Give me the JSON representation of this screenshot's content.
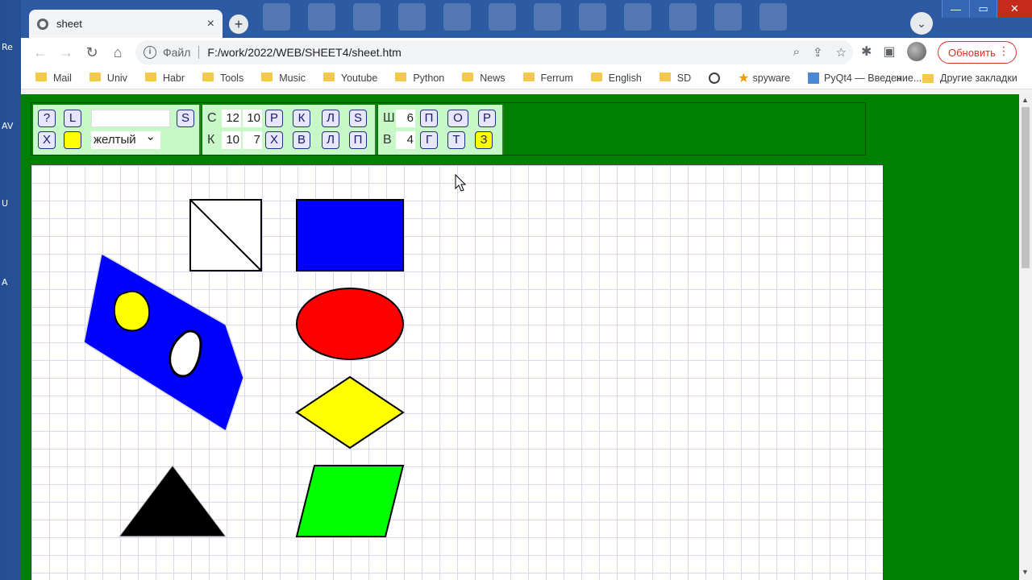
{
  "desktop": {
    "labels": [
      "Re",
      "AV",
      "U",
      "A"
    ]
  },
  "browser": {
    "tab_title": "sheet",
    "tab_close": "×",
    "new_tab": "+",
    "tab_list": "⌄",
    "window_controls": {
      "minimize": "—",
      "maximize": "▭",
      "close": "✕"
    },
    "nav": {
      "back": "←",
      "forward": "→",
      "reload": "↻",
      "home": "⌂"
    },
    "address": {
      "scheme_label": "Файл",
      "url": "F:/work/2022/WEB/SHEET4/sheet.htm"
    },
    "update_label": "Обновить",
    "bookmarks": [
      {
        "label": "Mail"
      },
      {
        "label": "Univ"
      },
      {
        "label": "Habr"
      },
      {
        "label": "Tools"
      },
      {
        "label": "Music"
      },
      {
        "label": "Youtube"
      },
      {
        "label": "Python"
      },
      {
        "label": "News"
      },
      {
        "label": "Ferrum"
      },
      {
        "label": "English"
      },
      {
        "label": "SD"
      }
    ],
    "bookmark_spyware": "spyware",
    "bookmark_pyqt": "PyQt4 — Введение...",
    "bookmarks_more": "»",
    "other_bookmarks": "Другие закладки"
  },
  "panel1": {
    "help": "?",
    "l": "L",
    "s": "S",
    "x": "Х",
    "text_value": "",
    "swatch_color": "#ffff00",
    "color_select": "желтый"
  },
  "panel2": {
    "c_label": "С",
    "c_val1": "12",
    "c_val2": "10",
    "k_label": "К",
    "k_val1": "10",
    "k_val2": "7",
    "r": "Р",
    "k": "К",
    "l": "Л",
    "s": "S",
    "x": "Х",
    "v": "В",
    "l2": "Л",
    "p": "П"
  },
  "panel3": {
    "w_label": "Ш",
    "w_val": "6",
    "h_label": "В",
    "h_val": "4",
    "p": "П",
    "o": "О",
    "r": "Р",
    "g": "Г",
    "t": "Т",
    "z": "З"
  },
  "shapes": {
    "colors": {
      "blue": "#0000ff",
      "red": "#ff0000",
      "yellow": "#ffff00",
      "green": "#00ff00",
      "black": "#000000",
      "white": "#ffffff"
    }
  }
}
